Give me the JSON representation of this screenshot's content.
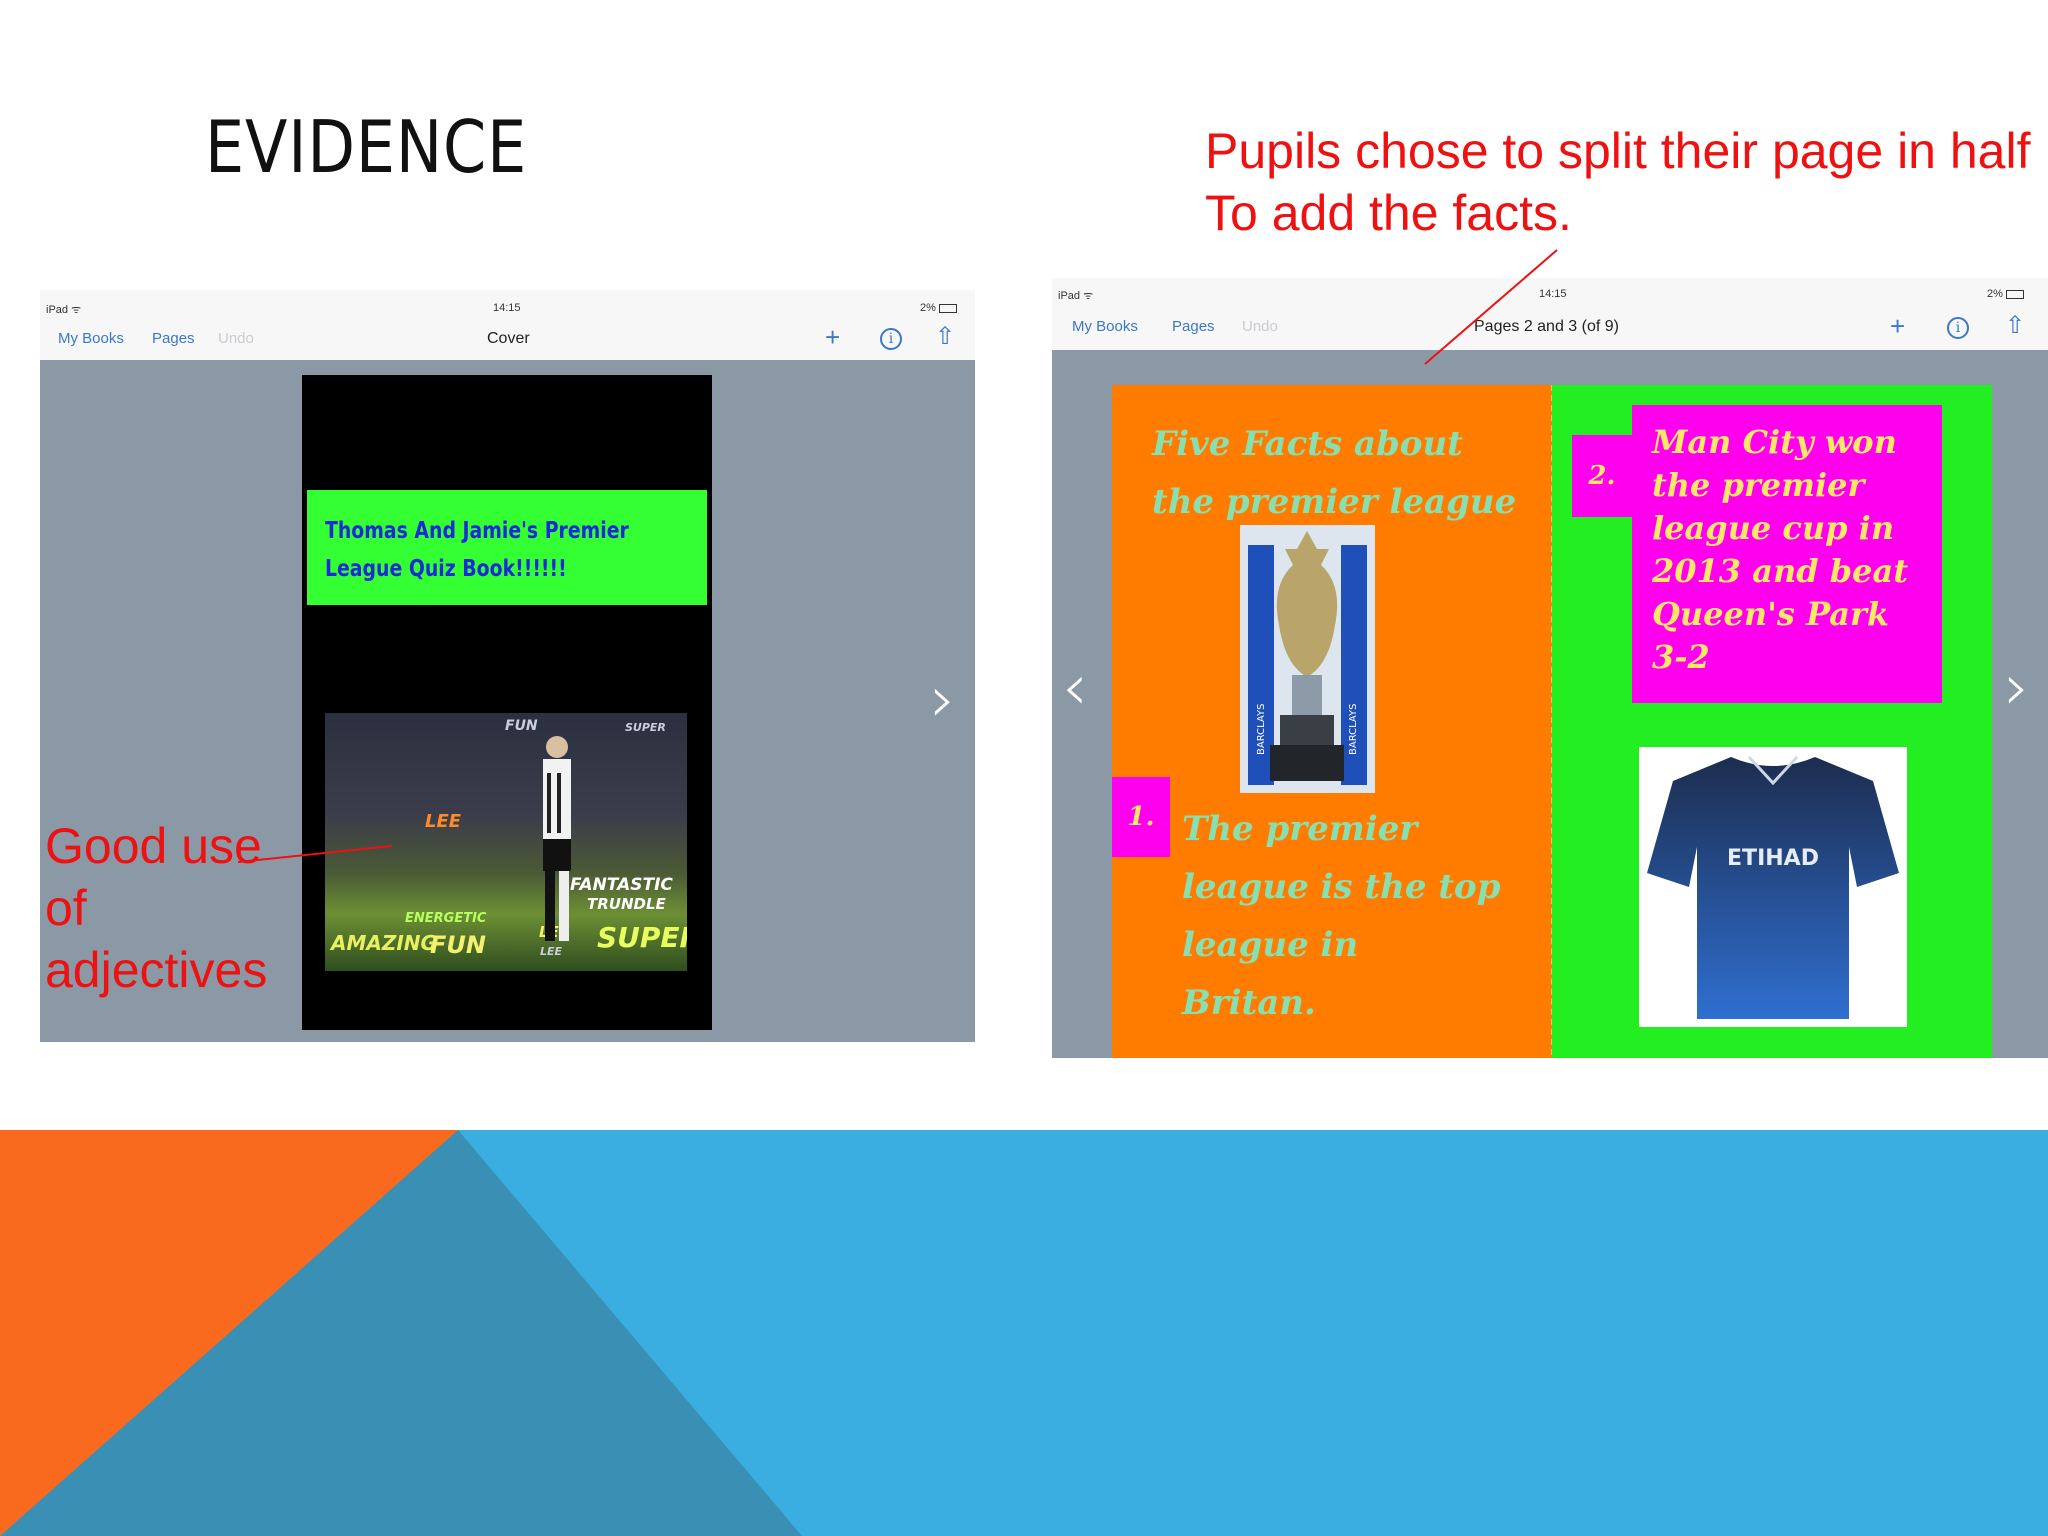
{
  "slide": {
    "title": "EVIDENCE",
    "annotation_top_line1": "Pupils chose to split their page in half",
    "annotation_top_line2": "To add the facts.",
    "annotation_left_line1": "Good use",
    "annotation_left_line2": "of",
    "annotation_left_line3": "adjectives"
  },
  "left_screen": {
    "status_left": "iPad ᯤ",
    "status_time": "14:15",
    "status_right": "2%",
    "nav_my_books": "My Books",
    "nav_pages": "Pages",
    "nav_undo": "Undo",
    "nav_title": "Cover",
    "cover_title_line1": "Thomas And Jamie's Premier",
    "cover_title_line2": "League Quiz Book!!!!!!",
    "wordcloud_words": [
      "FUN",
      "SUPER",
      "LEE",
      "FANTASTIC",
      "TRUNDLE",
      "AMAZING",
      "FUN",
      "ENERGETIC",
      "LEE",
      "SUPER",
      "LEE"
    ]
  },
  "right_screen": {
    "status_left": "iPad ᯤ",
    "status_time": "14:15",
    "status_right": "2%",
    "nav_my_books": "My Books",
    "nav_pages": "Pages",
    "nav_undo": "Undo",
    "nav_title": "Pages 2 and 3 (of 9)",
    "facts_title_line1": "Five Facts about",
    "facts_title_line2": "the premier league",
    "num1": "1.",
    "fact1_line1": "The premier",
    "fact1_line2": "league is the top",
    "fact1_line3": "league in",
    "fact1_line4": "Britan.",
    "num2": "2.",
    "fact2_line1": "Man City won",
    "fact2_line2": "the premier",
    "fact2_line3": "league cup in",
    "fact2_line4": "2013 and beat",
    "fact2_line5": "Queen's Park",
    "fact2_line6": "3-2",
    "shirt_sponsor": "ETIHAD",
    "trophy_banner": "BARCLAYS"
  },
  "colors": {
    "annotation_red": "#ee1111",
    "ipad_link_blue": "#3a78c9",
    "deco_orange": "#f96a1f",
    "deco_blue": "#3aaee0",
    "deco_dark_blue": "#3a90b4"
  }
}
